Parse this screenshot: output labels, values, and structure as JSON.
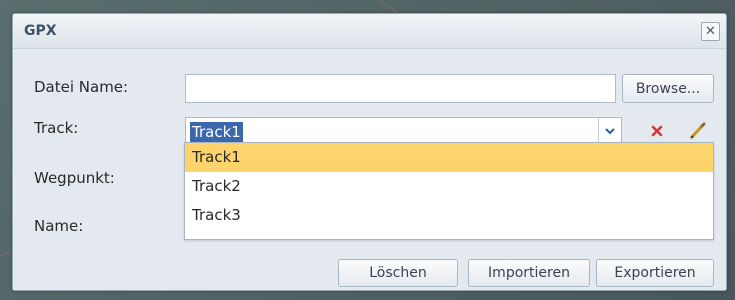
{
  "dialog": {
    "title": "GPX",
    "close_glyph": "✕"
  },
  "form": {
    "file_label": "Datei Name:",
    "file_value": "",
    "browse_label": "Browse...",
    "track_label": "Track:",
    "track_value": "Track1",
    "waypoint_label": "Wegpunkt:",
    "name_label": "Name:"
  },
  "dropdown": {
    "items": [
      {
        "label": "Track1",
        "selected": true
      },
      {
        "label": "Track2",
        "selected": false
      },
      {
        "label": "Track3",
        "selected": false
      }
    ]
  },
  "buttons": {
    "delete_label": "Löschen",
    "import_label": "Importieren",
    "export_label": "Exportieren"
  },
  "icons": {
    "combo_arrow": "chevron-down-icon",
    "delete": "delete-x-icon",
    "edit": "pencil-icon"
  },
  "colors": {
    "selection": "#3b67ad",
    "highlight": "#fdd36b",
    "delete_icon": "#d23a3a"
  }
}
